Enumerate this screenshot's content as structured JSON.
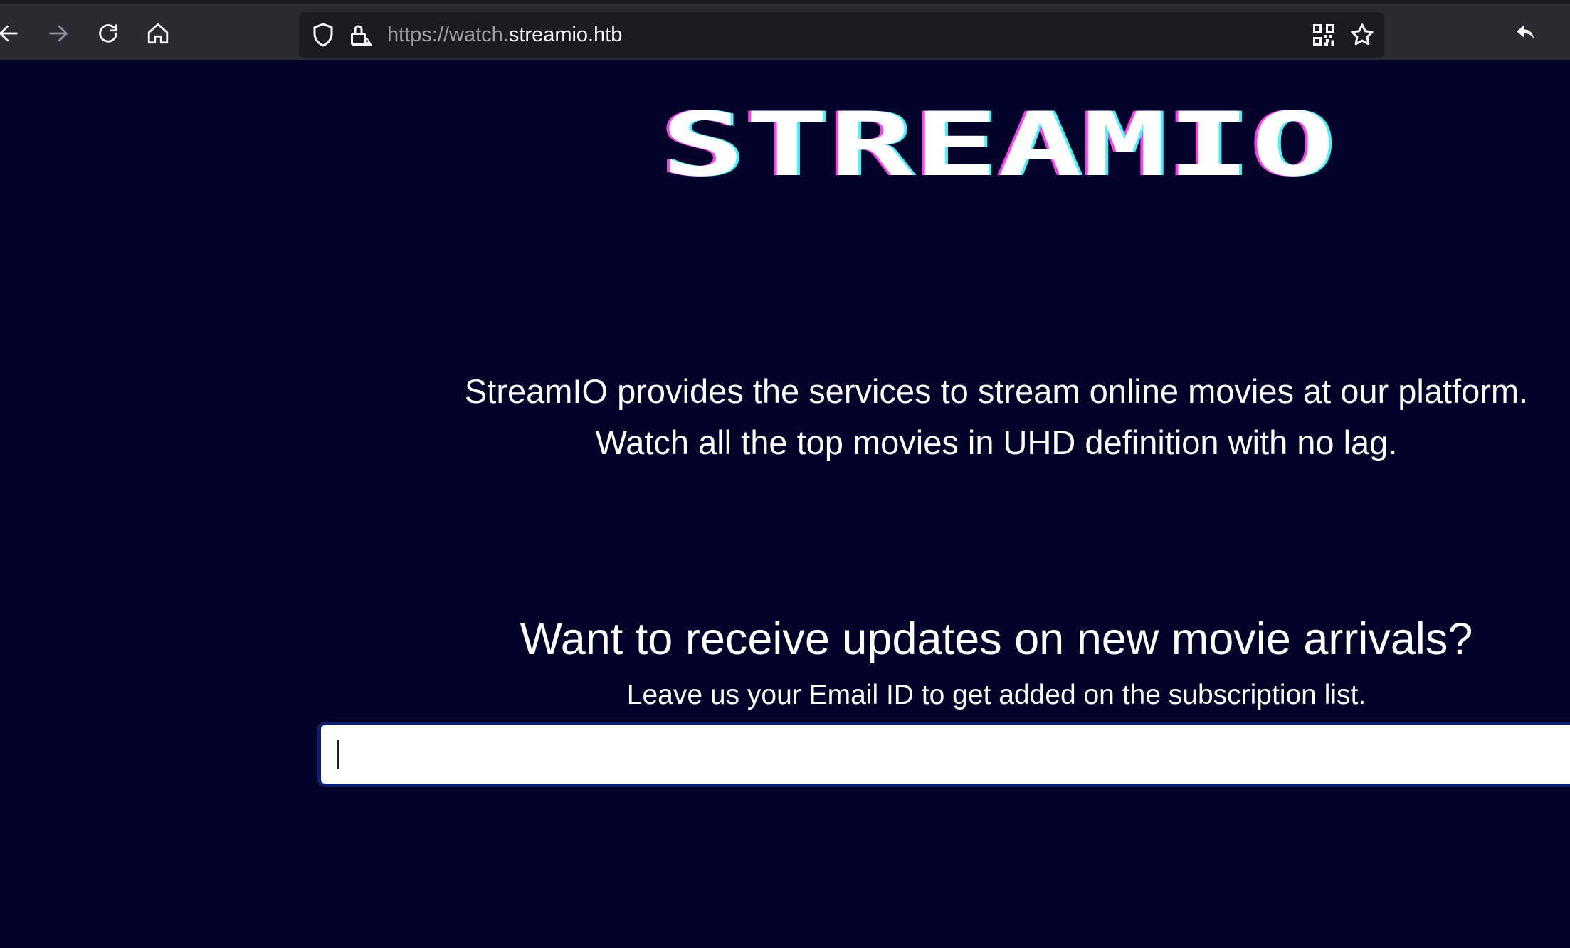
{
  "browser": {
    "url_prefix": "https://watch.",
    "url_domain": "streamio.htb",
    "icons": [
      "back-icon",
      "forward-icon",
      "reload-icon",
      "home-icon",
      "shield-icon",
      "insecure-lock-icon",
      "qr-code-icon",
      "bookmark-star-icon",
      "undo-icon"
    ],
    "forward_disabled": true
  },
  "page": {
    "logo_text": "STREAMIO",
    "description_line1": "StreamIO provides the services to stream online movies at our platform.",
    "description_line2": "Watch all the top movies in UHD definition with no lag.",
    "headline": "Want to receive updates on new movie arrivals?",
    "subheadline": "Leave us your Email ID to get added on the subscription list.",
    "email_value": "",
    "email_placeholder": ""
  },
  "colors": {
    "page_bg": "#03032a",
    "toolbar_bg": "#2b2a33",
    "urlbar_bg": "#1c1b22",
    "logo_pink": "#ff3ef2",
    "logo_cyan": "#3ff3ff",
    "input_border": "#0b1f6e"
  }
}
